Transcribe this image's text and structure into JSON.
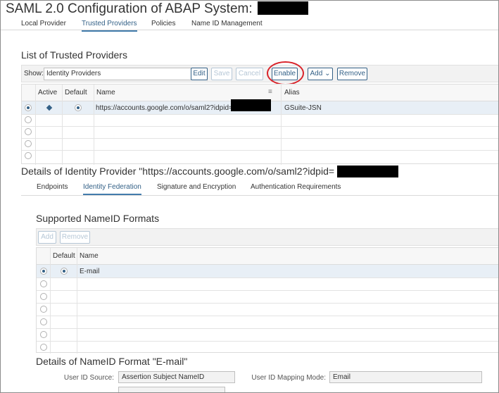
{
  "page": {
    "title": "SAML 2.0 Configuration of ABAP System:"
  },
  "top_tabs": [
    "Local Provider",
    "Trusted Providers",
    "Policies",
    "Name ID Management"
  ],
  "trusted_providers": {
    "heading": "List of Trusted Providers",
    "show_label": "Show:",
    "show_value": "Identity Providers",
    "buttons": {
      "edit": "Edit",
      "save": "Save",
      "cancel": "Cancel",
      "enable": "Enable",
      "add": "Add",
      "remove": "Remove"
    },
    "columns": [
      "Active",
      "Default",
      "Name",
      "Alias"
    ],
    "rows": [
      {
        "name": "https://accounts.google.com/o/saml2?idpid=",
        "alias": "GSuite-JSN"
      }
    ]
  },
  "details": {
    "heading": "Details of Identity Provider \"https://accounts.google.com/o/saml2?idpid=",
    "tabs": [
      "Endpoints",
      "Identity Federation",
      "Signature and Encryption",
      "Authentication Requirements"
    ]
  },
  "nameid_formats": {
    "heading": "Supported NameID Formats",
    "buttons": {
      "add": "Add",
      "remove": "Remove"
    },
    "columns": [
      "Default",
      "Name"
    ],
    "rows": [
      {
        "name": "E-mail"
      }
    ]
  },
  "nameid_details": {
    "heading": "Details of NameID Format \"E-mail\"",
    "user_id_source_label": "User ID Source:",
    "user_id_source_value": "Assertion Subject NameID",
    "user_id_mapping_label": "User ID Mapping Mode:",
    "user_id_mapping_value": "Email"
  },
  "colors": {
    "accent": "#346187",
    "selected_row": "#e8eff6",
    "highlight_circle": "#d9242b"
  },
  "icons": [
    "chevron-down-icon",
    "sort-icon",
    "radio-icon",
    "active-diamond-icon"
  ]
}
